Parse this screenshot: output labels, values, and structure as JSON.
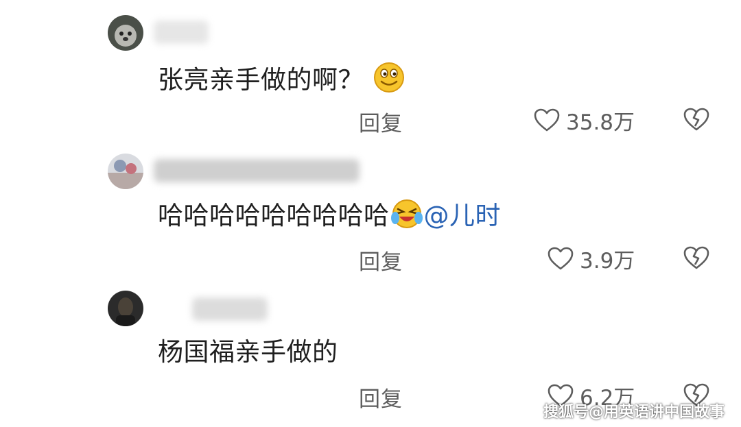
{
  "comments": [
    {
      "text": "张亮亲手做的啊？",
      "emoji": "smile-emoji",
      "mention": "",
      "reply_label": "回复",
      "likes": "35.8万"
    },
    {
      "text": "哈哈哈哈哈哈哈哈哈",
      "emoji": "laugh-cry-emoji",
      "mention": "@儿时",
      "reply_label": "回复",
      "likes": "3.9万"
    },
    {
      "text": "杨国福亲手做的",
      "emoji": "",
      "mention": "",
      "reply_label": "回复",
      "likes": "6.2万"
    }
  ],
  "icons": {
    "like": "heart-outline-icon",
    "dislike": "broken-heart-icon"
  },
  "colors": {
    "mention": "#2a63b4",
    "secondary_text": "#5d5d5d"
  },
  "watermark": "搜狐号@用英语讲中国故事"
}
